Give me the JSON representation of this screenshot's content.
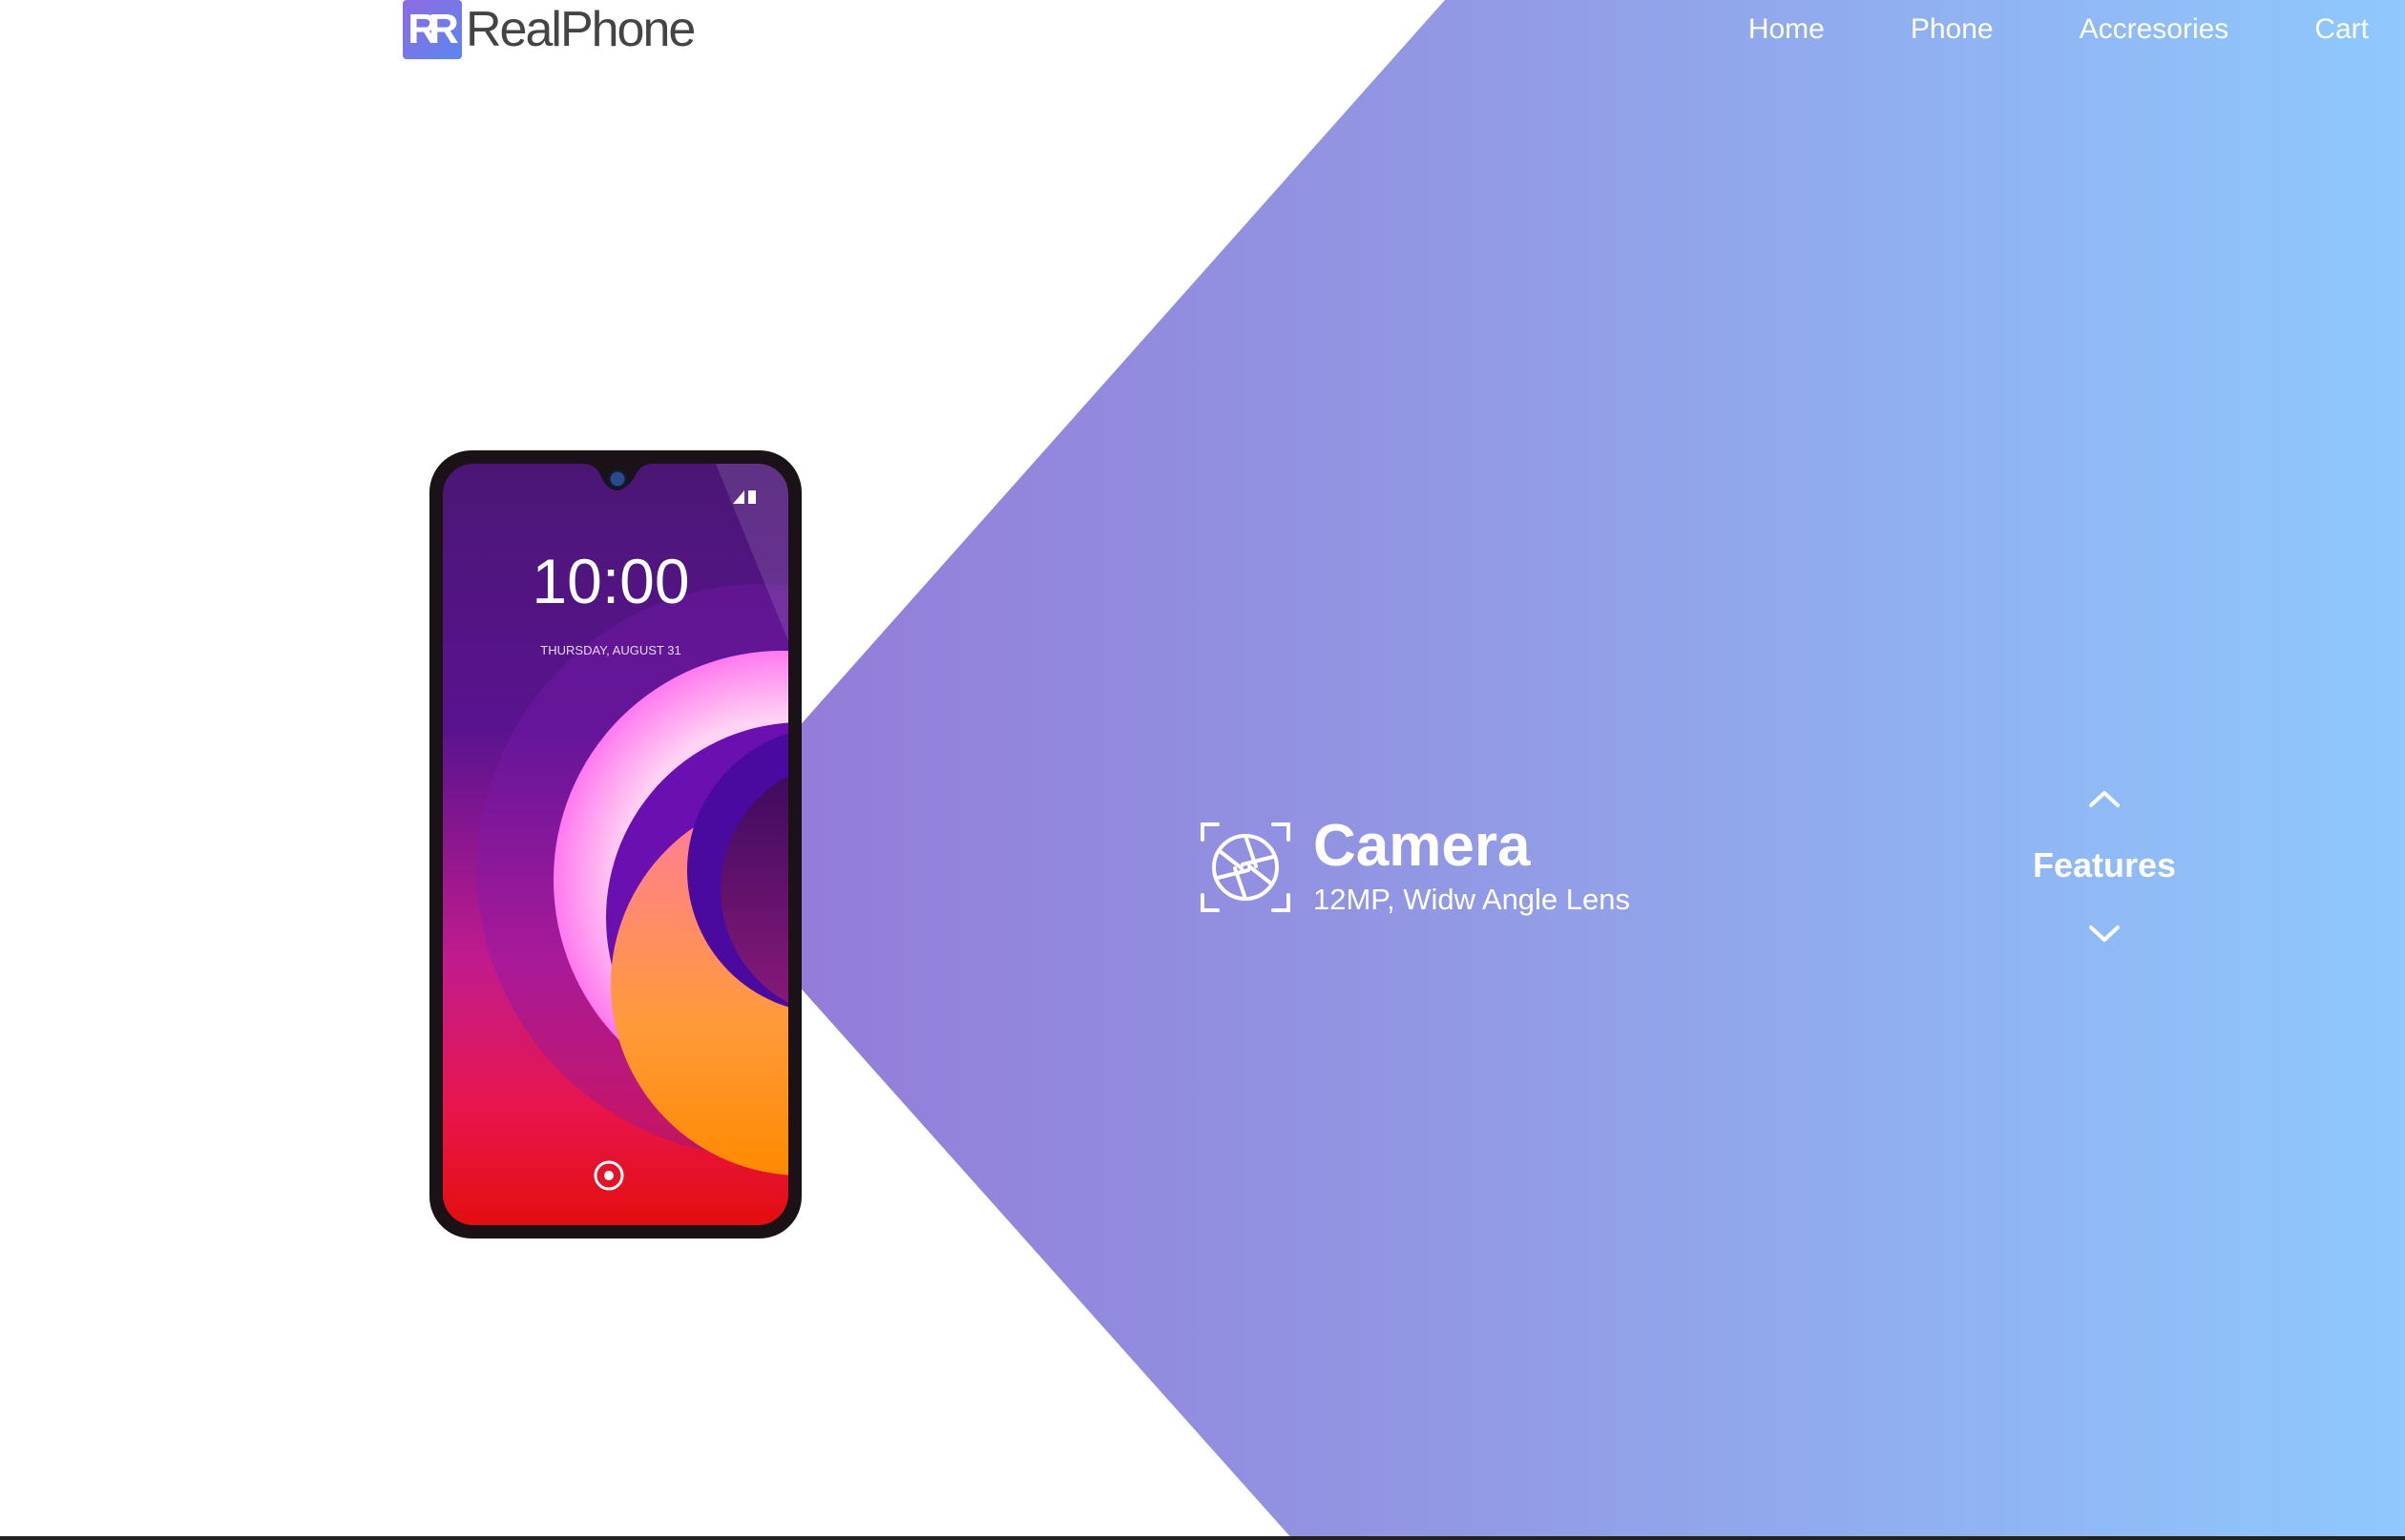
{
  "brand": {
    "mark": "RR",
    "name": "RealPhone"
  },
  "nav": {
    "items": [
      "Home",
      "Phone",
      "Accresories",
      "Cart"
    ]
  },
  "phone_screen": {
    "time": "10:00",
    "date": "THURSDAY, AUGUST 31"
  },
  "feature": {
    "icon": "camera-aperture-icon",
    "title": "Camera",
    "subtitle": "12MP, Widw Angle Lens"
  },
  "switcher": {
    "label": "Features"
  },
  "colors": {
    "gradient_start": "#9467cf",
    "gradient_end": "#8fc9fd",
    "text_on_gradient": "#ffffff",
    "logo_text": "#444444"
  }
}
